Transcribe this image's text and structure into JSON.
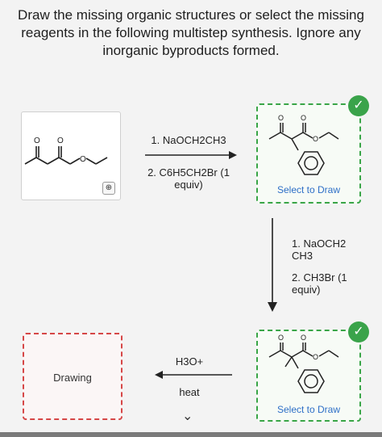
{
  "instructions": "Draw the missing organic structures or select the missing reagents in the following multistep synthesis. Ignore any inorganic byproducts formed.",
  "step1": {
    "reagent1": "1. NaOCH2CH3",
    "reagent2_line1": "2. C6H5CH2Br (1",
    "reagent2_line2": "equiv)"
  },
  "step2": {
    "reagent1_line1": "1. NaOCH2",
    "reagent1_line2": "CH3",
    "reagent2_line1": "2. CH3Br (1",
    "reagent2_line2": "equiv)"
  },
  "step3": {
    "reagent1": "H3O+",
    "reagent2": "heat"
  },
  "product1": {
    "link": "Select to Draw"
  },
  "product2": {
    "link": "Select to Draw"
  },
  "final": {
    "label": "Drawing"
  },
  "icons": {
    "check": "check-icon",
    "zoom": "magnify-icon",
    "chevron": "chevron-down-icon"
  },
  "colors": {
    "correct": "#3aa34a",
    "link": "#2d6fc7",
    "empty_box": "#d64747"
  }
}
